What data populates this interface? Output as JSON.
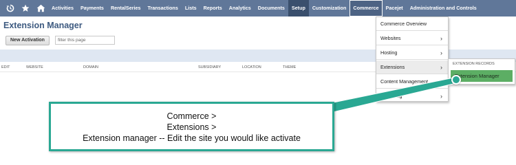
{
  "nav": {
    "icons": [
      "recent-records-icon",
      "star-icon",
      "home-icon"
    ],
    "items": [
      "Activities",
      "Payments",
      "RentalSeries",
      "Transactions",
      "Lists",
      "Reports",
      "Analytics",
      "Documents",
      "Setup",
      "Customization",
      "Commerce",
      "Pacejet",
      "Administration and Controls"
    ],
    "active": "Commerce",
    "bar_color": "#607799"
  },
  "page": {
    "title": "Extension Manager",
    "new_button": "New Activation",
    "filter_placeholder": "filter this page",
    "columns": [
      "EDIT",
      "WEBSITE",
      "DOMAIN",
      "SUBSIDIARY",
      "LOCATION",
      "THEME"
    ]
  },
  "commerce_menu": {
    "items": [
      {
        "label": "Commerce Overview",
        "arrow": ""
      },
      {
        "label": "Websites",
        "arrow": "›"
      },
      {
        "label": "Hosting",
        "arrow": "›"
      },
      {
        "label": "Extensions",
        "arrow": "›"
      },
      {
        "label": "Content Management",
        "arrow": "›"
      },
      {
        "label": "Marketing",
        "arrow": "›"
      }
    ]
  },
  "extensions_submenu": {
    "header": "EXTENSION RECORDS",
    "item": "Extension Manager",
    "highlight_color": "#5cae64"
  },
  "callout": {
    "lines": [
      "Commerce >",
      "Extensions >",
      "Extension manager -- Edit the site you would like activate"
    ],
    "color": "#2aa893"
  }
}
